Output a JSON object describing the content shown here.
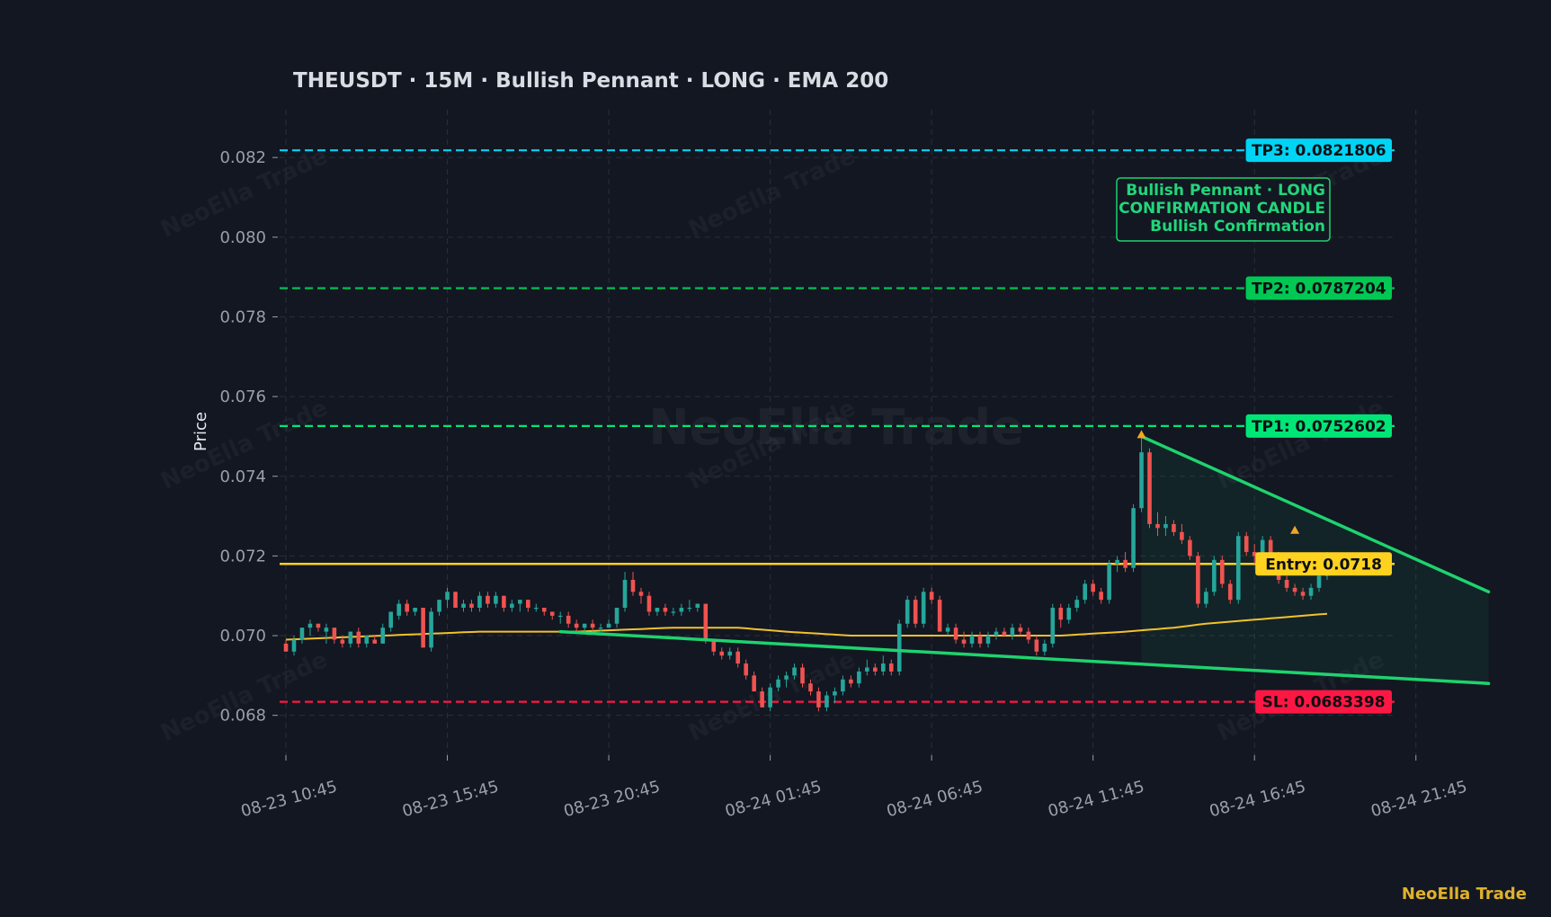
{
  "title": "THEUSDT  ·  15M  ·  Bullish Pennant  ·  LONG  ·  EMA 200",
  "watermark": "NeoElla Trade",
  "brand": "NeoElla Trade",
  "colors": {
    "background": "#121722",
    "grid": "#2a2f3a",
    "up": "#26a69a",
    "down": "#ef5350",
    "ema": "#f2c12e",
    "entry": "#ffd21f",
    "tp1": "#00e676",
    "tp2": "#00c853",
    "tp3": "#00d4f5",
    "sl": "#ff1744",
    "pattern": "#1ed36e"
  },
  "annotation": {
    "lines": [
      "Bullish Pennant · LONG",
      "CONFIRMATION CANDLE",
      "Bullish Confirmation"
    ]
  },
  "chart_data": {
    "type": "candlestick",
    "title": "THEUSDT  ·  15M  ·  Bullish Pennant  ·  LONG  ·  EMA 200",
    "ylabel": "Price",
    "xlabel": "",
    "ylim": [
      0.067,
      0.0832
    ],
    "y_ticks": [
      "0.068",
      "0.070",
      "0.072",
      "0.074",
      "0.076",
      "0.078",
      "0.080",
      "0.082"
    ],
    "x_ticks": [
      "08-23 10:45",
      "08-23 15:45",
      "08-23 20:45",
      "08-24 01:45",
      "08-24 06:45",
      "08-24 11:45",
      "08-24 16:45",
      "08-24 21:45"
    ],
    "grid": true,
    "levels": [
      {
        "name": "TP3",
        "label": "TP3: 0.0821806",
        "value": 0.0821806,
        "style": "dashed",
        "color": "#00d4f5"
      },
      {
        "name": "TP2",
        "label": "TP2: 0.0787204",
        "value": 0.0787204,
        "style": "dashed",
        "color": "#00c853"
      },
      {
        "name": "TP1",
        "label": "TP1: 0.0752602",
        "value": 0.0752602,
        "style": "dashed",
        "color": "#00e676"
      },
      {
        "name": "Entry",
        "label": "Entry: 0.0718",
        "value": 0.0718,
        "style": "solid",
        "color": "#ffd21f"
      },
      {
        "name": "SL",
        "label": "SL: 0.0683398",
        "value": 0.0683398,
        "style": "dashed",
        "color": "#ff1744"
      }
    ],
    "candles": [
      [
        0.0698,
        0.0699,
        0.0696,
        0.0696
      ],
      [
        0.0696,
        0.07,
        0.0695,
        0.0699
      ],
      [
        0.0699,
        0.0702,
        0.0698,
        0.0702
      ],
      [
        0.0702,
        0.0704,
        0.07,
        0.0703
      ],
      [
        0.0703,
        0.0703,
        0.0701,
        0.0702
      ],
      [
        0.0701,
        0.0703,
        0.0698,
        0.0702
      ],
      [
        0.0702,
        0.0702,
        0.0698,
        0.0699
      ],
      [
        0.0699,
        0.07,
        0.0697,
        0.0698
      ],
      [
        0.0698,
        0.0701,
        0.0697,
        0.0701
      ],
      [
        0.0701,
        0.0702,
        0.0697,
        0.0698
      ],
      [
        0.0698,
        0.07,
        0.0697,
        0.07
      ],
      [
        0.0699,
        0.07,
        0.0698,
        0.0698
      ],
      [
        0.0698,
        0.0703,
        0.0698,
        0.0702
      ],
      [
        0.0702,
        0.0706,
        0.0701,
        0.0706
      ],
      [
        0.0705,
        0.0709,
        0.0704,
        0.0708
      ],
      [
        0.0708,
        0.0709,
        0.0705,
        0.0706
      ],
      [
        0.0706,
        0.0707,
        0.0705,
        0.0707
      ],
      [
        0.0707,
        0.0707,
        0.0697,
        0.0697
      ],
      [
        0.0697,
        0.0707,
        0.0696,
        0.0706
      ],
      [
        0.0706,
        0.0709,
        0.0705,
        0.0709
      ],
      [
        0.0709,
        0.0712,
        0.0707,
        0.0711
      ],
      [
        0.0711,
        0.0711,
        0.0707,
        0.0707
      ],
      [
        0.0707,
        0.0709,
        0.0706,
        0.0708
      ],
      [
        0.0708,
        0.0709,
        0.0706,
        0.0707
      ],
      [
        0.0707,
        0.0711,
        0.0706,
        0.071
      ],
      [
        0.071,
        0.0711,
        0.0707,
        0.0708
      ],
      [
        0.0708,
        0.0711,
        0.0707,
        0.071
      ],
      [
        0.071,
        0.071,
        0.0706,
        0.0707
      ],
      [
        0.0707,
        0.0709,
        0.0706,
        0.0708
      ],
      [
        0.0708,
        0.0709,
        0.0706,
        0.0709
      ],
      [
        0.0709,
        0.0709,
        0.0706,
        0.0707
      ],
      [
        0.0707,
        0.0708,
        0.0706,
        0.0707
      ],
      [
        0.0707,
        0.0707,
        0.0705,
        0.0706
      ],
      [
        0.0706,
        0.0706,
        0.0704,
        0.0705
      ],
      [
        0.0705,
        0.0706,
        0.0703,
        0.0705
      ],
      [
        0.0705,
        0.0706,
        0.0702,
        0.0703
      ],
      [
        0.0703,
        0.0704,
        0.0701,
        0.0702
      ],
      [
        0.0702,
        0.0703,
        0.0701,
        0.0703
      ],
      [
        0.0703,
        0.0704,
        0.0701,
        0.0702
      ],
      [
        0.0702,
        0.0703,
        0.0701,
        0.0702
      ],
      [
        0.0702,
        0.0704,
        0.0702,
        0.0703
      ],
      [
        0.0703,
        0.0707,
        0.0702,
        0.0707
      ],
      [
        0.0707,
        0.0716,
        0.0706,
        0.0714
      ],
      [
        0.0714,
        0.0716,
        0.071,
        0.0711
      ],
      [
        0.0711,
        0.0712,
        0.0708,
        0.071
      ],
      [
        0.071,
        0.0711,
        0.0705,
        0.0706
      ],
      [
        0.0706,
        0.0707,
        0.0705,
        0.0707
      ],
      [
        0.0707,
        0.0708,
        0.0705,
        0.0706
      ],
      [
        0.0706,
        0.0707,
        0.0705,
        0.0706
      ],
      [
        0.0706,
        0.0708,
        0.0705,
        0.0707
      ],
      [
        0.0707,
        0.0709,
        0.0706,
        0.0707
      ],
      [
        0.0707,
        0.0708,
        0.0706,
        0.0708
      ],
      [
        0.0708,
        0.0708,
        0.0698,
        0.0699
      ],
      [
        0.0699,
        0.0699,
        0.0695,
        0.0696
      ],
      [
        0.0696,
        0.0697,
        0.0694,
        0.0695
      ],
      [
        0.0695,
        0.0697,
        0.0694,
        0.0696
      ],
      [
        0.0696,
        0.0697,
        0.0692,
        0.0693
      ],
      [
        0.0693,
        0.0694,
        0.0689,
        0.069
      ],
      [
        0.069,
        0.0691,
        0.0686,
        0.0686
      ],
      [
        0.0686,
        0.0687,
        0.0682,
        0.0682
      ],
      [
        0.0682,
        0.0688,
        0.0681,
        0.0687
      ],
      [
        0.0687,
        0.069,
        0.0686,
        0.0689
      ],
      [
        0.0689,
        0.0691,
        0.0687,
        0.069
      ],
      [
        0.069,
        0.0693,
        0.0689,
        0.0692
      ],
      [
        0.0692,
        0.0693,
        0.0687,
        0.0688
      ],
      [
        0.0688,
        0.0689,
        0.0685,
        0.0686
      ],
      [
        0.0686,
        0.0687,
        0.0681,
        0.0682
      ],
      [
        0.0682,
        0.0686,
        0.0681,
        0.0685
      ],
      [
        0.0685,
        0.0687,
        0.0683,
        0.0686
      ],
      [
        0.0686,
        0.069,
        0.0685,
        0.0689
      ],
      [
        0.0689,
        0.069,
        0.0687,
        0.0688
      ],
      [
        0.0688,
        0.0692,
        0.0687,
        0.0691
      ],
      [
        0.0691,
        0.0694,
        0.069,
        0.0692
      ],
      [
        0.0692,
        0.0693,
        0.069,
        0.0691
      ],
      [
        0.0691,
        0.0695,
        0.069,
        0.0693
      ],
      [
        0.0693,
        0.0694,
        0.069,
        0.0691
      ],
      [
        0.0691,
        0.0704,
        0.069,
        0.0703
      ],
      [
        0.0703,
        0.071,
        0.0702,
        0.0709
      ],
      [
        0.0709,
        0.071,
        0.0702,
        0.0703
      ],
      [
        0.0703,
        0.0712,
        0.0702,
        0.0711
      ],
      [
        0.0711,
        0.0712,
        0.0708,
        0.0709
      ],
      [
        0.0709,
        0.071,
        0.0701,
        0.0701
      ],
      [
        0.0701,
        0.0703,
        0.07,
        0.0702
      ],
      [
        0.0702,
        0.0703,
        0.0698,
        0.0699
      ],
      [
        0.0699,
        0.0701,
        0.0697,
        0.0698
      ],
      [
        0.0698,
        0.0701,
        0.0697,
        0.07
      ],
      [
        0.07,
        0.0701,
        0.0697,
        0.0698
      ],
      [
        0.0698,
        0.0701,
        0.0697,
        0.07
      ],
      [
        0.07,
        0.0702,
        0.0699,
        0.0701
      ],
      [
        0.0701,
        0.0702,
        0.07,
        0.07
      ],
      [
        0.07,
        0.0703,
        0.0699,
        0.0702
      ],
      [
        0.0702,
        0.0703,
        0.07,
        0.0701
      ],
      [
        0.0701,
        0.0702,
        0.0698,
        0.0699
      ],
      [
        0.0699,
        0.07,
        0.0695,
        0.0696
      ],
      [
        0.0696,
        0.0699,
        0.0695,
        0.0698
      ],
      [
        0.0698,
        0.0708,
        0.0697,
        0.0707
      ],
      [
        0.0707,
        0.0708,
        0.0702,
        0.0704
      ],
      [
        0.0704,
        0.0708,
        0.0703,
        0.0707
      ],
      [
        0.0707,
        0.071,
        0.0706,
        0.0709
      ],
      [
        0.0709,
        0.0714,
        0.0708,
        0.0713
      ],
      [
        0.0713,
        0.0714,
        0.071,
        0.0711
      ],
      [
        0.0711,
        0.0712,
        0.0708,
        0.0709
      ],
      [
        0.0709,
        0.0719,
        0.0708,
        0.0718
      ],
      [
        0.0718,
        0.072,
        0.0716,
        0.0719
      ],
      [
        0.0719,
        0.0721,
        0.0716,
        0.0717
      ],
      [
        0.0717,
        0.0733,
        0.0716,
        0.0732
      ],
      [
        0.0732,
        0.075,
        0.0731,
        0.0746
      ],
      [
        0.0746,
        0.0747,
        0.0727,
        0.0728
      ],
      [
        0.0728,
        0.0731,
        0.0725,
        0.0727
      ],
      [
        0.0727,
        0.073,
        0.0725,
        0.0728
      ],
      [
        0.0728,
        0.0729,
        0.0725,
        0.0726
      ],
      [
        0.0726,
        0.0728,
        0.0723,
        0.0724
      ],
      [
        0.0724,
        0.0725,
        0.0719,
        0.072
      ],
      [
        0.072,
        0.0721,
        0.0707,
        0.0708
      ],
      [
        0.0708,
        0.0712,
        0.0707,
        0.0711
      ],
      [
        0.0711,
        0.072,
        0.071,
        0.0719
      ],
      [
        0.0719,
        0.072,
        0.0712,
        0.0713
      ],
      [
        0.0713,
        0.0714,
        0.0708,
        0.0709
      ],
      [
        0.0709,
        0.0726,
        0.0708,
        0.0725
      ],
      [
        0.0725,
        0.0726,
        0.072,
        0.0721
      ],
      [
        0.0721,
        0.0723,
        0.0718,
        0.072
      ],
      [
        0.072,
        0.0725,
        0.0719,
        0.0724
      ],
      [
        0.0724,
        0.0725,
        0.0719,
        0.072
      ],
      [
        0.072,
        0.0721,
        0.0713,
        0.0714
      ],
      [
        0.0714,
        0.0715,
        0.0711,
        0.0712
      ],
      [
        0.0712,
        0.0713,
        0.071,
        0.0711
      ],
      [
        0.0711,
        0.0712,
        0.0709,
        0.071
      ],
      [
        0.071,
        0.0713,
        0.0709,
        0.0712
      ],
      [
        0.0712,
        0.0716,
        0.0711,
        0.0715
      ],
      [
        0.0715,
        0.0721,
        0.0714,
        0.0719
      ]
    ],
    "ema_200": [
      [
        0,
        0.0699
      ],
      [
        12,
        0.07
      ],
      [
        24,
        0.0701
      ],
      [
        36,
        0.0701
      ],
      [
        48,
        0.0702
      ],
      [
        56,
        0.0702
      ],
      [
        62,
        0.0701
      ],
      [
        70,
        0.07
      ],
      [
        78,
        0.07
      ],
      [
        86,
        0.07
      ],
      [
        96,
        0.07
      ],
      [
        104,
        0.0701
      ],
      [
        110,
        0.0702
      ],
      [
        114,
        0.0703
      ],
      [
        120,
        0.0704
      ],
      [
        126,
        0.0705
      ],
      [
        132,
        0.0706
      ],
      [
        140,
        0.0706
      ]
    ],
    "pattern": {
      "name": "Bullish Pennant",
      "upper_line": [
        [
          106,
          0.075
        ],
        [
          149,
          0.0711
        ]
      ],
      "lower_line": [
        [
          34,
          0.0701
        ],
        [
          149,
          0.0688
        ]
      ],
      "pivot_markers": [
        [
          106,
          0.075
        ],
        [
          125,
          0.0726
        ]
      ]
    }
  }
}
